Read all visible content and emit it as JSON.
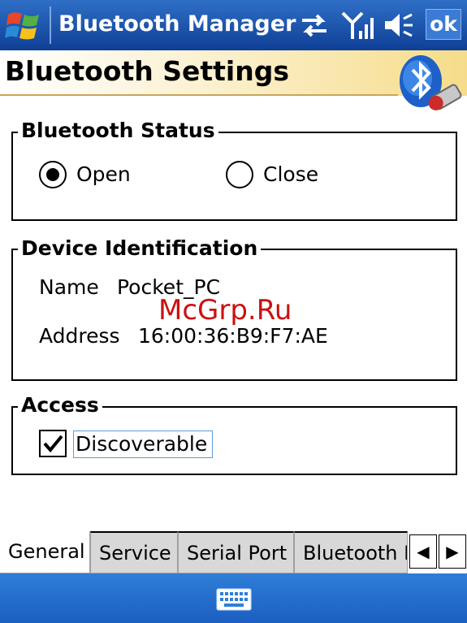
{
  "titlebar": {
    "title": "Bluetooth Manager",
    "ok_label": "ok",
    "icons": [
      "windows-logo",
      "sync-arrows-icon",
      "signal-icon",
      "speaker-icon"
    ],
    "color": "#1e58b4"
  },
  "header": {
    "title": "Bluetooth Settings"
  },
  "status_group": {
    "legend": "Bluetooth Status",
    "options": [
      {
        "label": "Open",
        "selected": true
      },
      {
        "label": "Close",
        "selected": false
      }
    ]
  },
  "device_group": {
    "legend": "Device Identification",
    "name_label": "Name",
    "name_value": "Pocket_PC",
    "address_label": "Address",
    "address_value": "16:00:36:B9:F7:AE"
  },
  "access_group": {
    "legend": "Access",
    "discoverable_label": "Discoverable",
    "discoverable_checked": true
  },
  "tabs": [
    {
      "label": "General",
      "active": true
    },
    {
      "label": "Service",
      "active": false
    },
    {
      "label": "Serial Port",
      "active": false
    },
    {
      "label": "Bluetooth H",
      "active": false
    }
  ],
  "watermark": "McGrp.Ru"
}
